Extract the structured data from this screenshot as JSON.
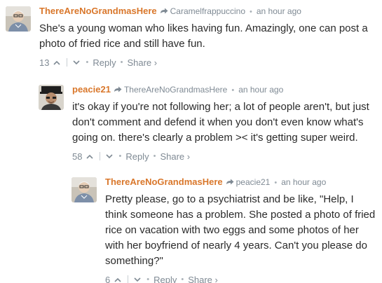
{
  "comments": [
    {
      "author": "ThereAreNoGrandmasHere",
      "reply_to": "Caramelfrappuccino",
      "time": "an hour ago",
      "text": "She's a young woman who likes having fun. Amazingly, one can post a photo of fried rice and still have fun.",
      "votes": "13",
      "reply_label": "Reply",
      "share_label": "Share ›"
    },
    {
      "author": "peacie21",
      "reply_to": "ThereAreNoGrandmasHere",
      "time": "an hour ago",
      "text": "it's okay if you're not following her; a lot of people aren't, but just don't comment and defend it when you don't even know what's going on. there's clearly a problem >< it's getting super weird.",
      "votes": "58",
      "reply_label": "Reply",
      "share_label": "Share ›"
    },
    {
      "author": "ThereAreNoGrandmasHere",
      "reply_to": "peacie21",
      "time": "an hour ago",
      "text": "Pretty please, go to a psychiatrist and be like, \"Help, I think someone has a problem. She posted a photo of fried rice on vacation with two eggs and some photos of her with her boyfriend of nearly 4 years. Can't you please do something?\"",
      "votes": "6",
      "reply_label": "Reply",
      "share_label": "Share ›"
    }
  ],
  "icons": {
    "reply_arrow": "reply-arrow-icon",
    "upvote": "upvote-icon",
    "downvote": "downvote-icon"
  },
  "colors": {
    "author": "#d9772b",
    "meta": "#7f8a94",
    "text": "#2a2a2a"
  }
}
